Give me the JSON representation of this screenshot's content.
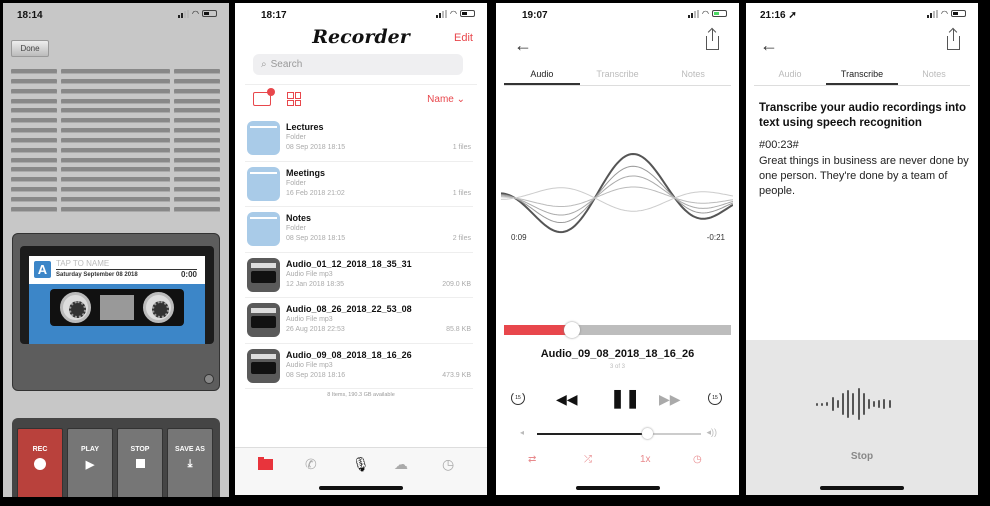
{
  "panel_recorder": {
    "status_time": "18:14",
    "done_label": "Done",
    "cassette": {
      "logo_letter": "A",
      "name_placeholder": "TAP TO NAME",
      "date": "Saturday September 08 2018",
      "elapsed": "0:00"
    },
    "buttons": [
      {
        "label": "REC",
        "icon": "record-dot-icon"
      },
      {
        "label": "PLAY",
        "icon": "play-icon"
      },
      {
        "label": "STOP",
        "icon": "stop-icon"
      },
      {
        "label": "SAVE AS",
        "icon": "download-icon"
      }
    ],
    "glyphs": {
      "play": "▶",
      "save": "⤓"
    }
  },
  "panel_files": {
    "status_time": "18:17",
    "app_title": "Recorder",
    "edit_label": "Edit",
    "search_placeholder": "Search",
    "search_glyph": "⌕",
    "sort_label": "Name ⌄",
    "files": [
      {
        "name": "Lectures",
        "type": "Folder",
        "date": "08 Sep 2018 18:15",
        "size": "1 files",
        "kind": "folder"
      },
      {
        "name": "Meetings",
        "type": "Folder",
        "date": "16 Feb 2018 21:02",
        "size": "1 files",
        "kind": "folder"
      },
      {
        "name": "Notes",
        "type": "Folder",
        "date": "08 Sep 2018 18:15",
        "size": "2 files",
        "kind": "folder"
      },
      {
        "name": "Audio_01_12_2018_18_35_31",
        "type": "Audio File mp3",
        "date": "12 Jan 2018 18:35",
        "size": "209.0 KB",
        "kind": "audio"
      },
      {
        "name": "Audio_08_26_2018_22_53_08",
        "type": "Audio File mp3",
        "date": "26 Aug 2018 22:53",
        "size": "85.8 KB",
        "kind": "audio"
      },
      {
        "name": "Audio_09_08_2018_18_16_26",
        "type": "Audio File mp3",
        "date": "08 Sep 2018 18:16",
        "size": "473.9 KB",
        "kind": "audio"
      }
    ],
    "storage_note": "8 Items, 190.3 GB available",
    "tab_icons": [
      "folder-icon",
      "phone-icon",
      "microphone-icon",
      "cloud-icon",
      "clock-icon"
    ],
    "tab_glyphs": {
      "phone": "✆",
      "mic": "🎙",
      "cloud": "☁",
      "clock": "◷"
    },
    "accent_color": "#e8474c"
  },
  "panel_player": {
    "status_time": "19:07",
    "back_glyph": "←",
    "tabs": [
      "Audio",
      "Transcribe",
      "Notes"
    ],
    "active_tab": 0,
    "elapsed": "0:09",
    "remaining": "-0:21",
    "progress": 0.3,
    "track_title": "Audio_09_08_2018_18_16_26",
    "track_position": "3 of 3",
    "controls": {
      "skip_back": "15",
      "rewind": "◀◀",
      "pause": "❚❚",
      "fast_forward": "▶▶",
      "skip_forward": "15"
    },
    "volume": 0.67,
    "volume_min_glyph": "◂",
    "volume_max_glyph": "◂))",
    "options": {
      "repeat": "⇄",
      "shuffle": "⤮",
      "speed": "1x",
      "timer": "◷"
    }
  },
  "panel_transcribe": {
    "status_time": "21:16 ➚",
    "back_glyph": "←",
    "tabs": [
      "Audio",
      "Transcribe",
      "Notes"
    ],
    "active_tab": 1,
    "heading": "Transcribe your audio recordings into text using speech recognition",
    "timestamp": "#00:23#",
    "transcript": "Great things in business are never done by one person. They're done by a team of people.",
    "stop_label": "Stop"
  }
}
